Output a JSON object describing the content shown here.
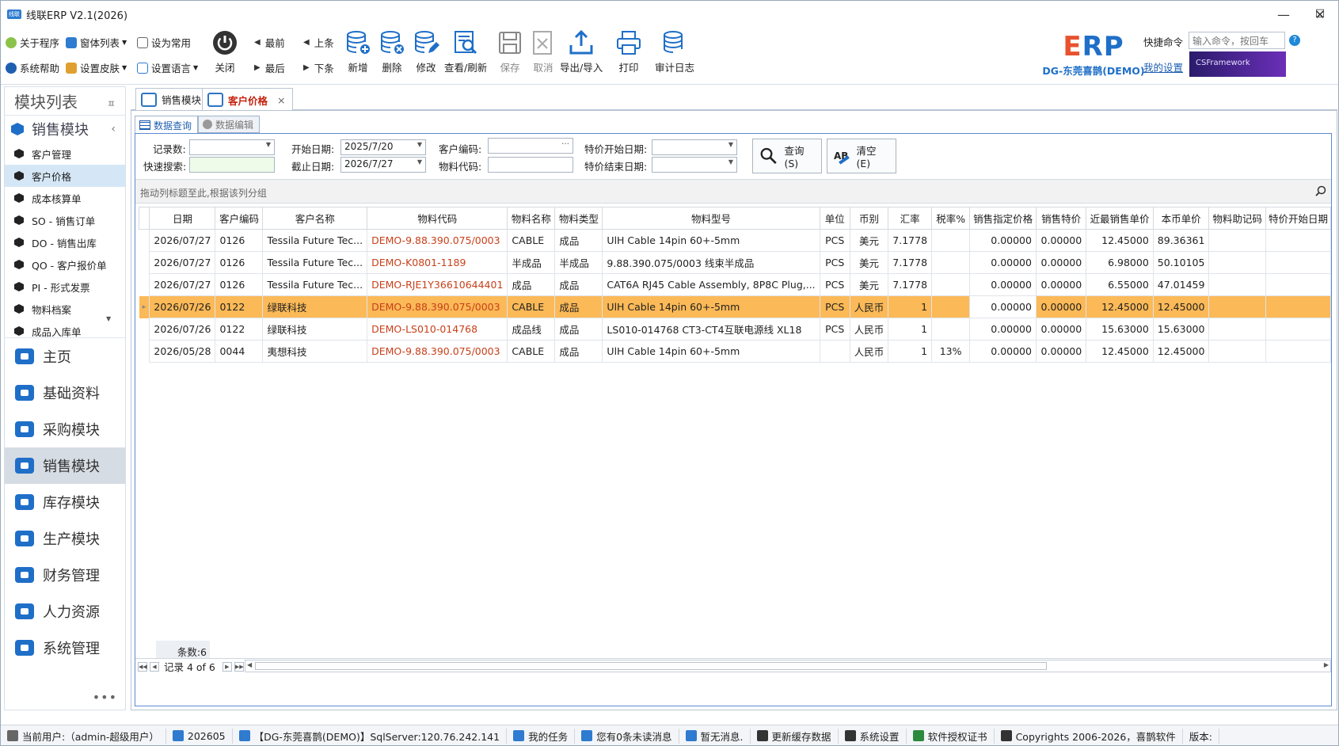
{
  "window": {
    "title": "线联ERP V2.1(2026)",
    "logo_text": "线联"
  },
  "toolbar": {
    "about": "关于程序",
    "window_list": "窗体列表",
    "set_common": "设为常用",
    "help": "系统帮助",
    "skin": "设置皮肤",
    "language": "设置语言",
    "close": "关闭",
    "first": "最前",
    "prev": "上条",
    "last": "最后",
    "next": "下条",
    "add": "新增",
    "delete": "删除",
    "edit": "修改",
    "view": "查看/刷新",
    "save": "保存",
    "cancel": "取消",
    "export": "导出/导入",
    "print": "打印",
    "audit": "审计日志"
  },
  "brand": {
    "erp_e": "E",
    "erp_rest": "RP",
    "company": "DG-东莞喜鹊(DEMO)",
    "framework": "CSFramework"
  },
  "quick": {
    "label": "快捷命令",
    "placeholder": "输入命令，按回车",
    "help": "?",
    "my_settings": "我的设置"
  },
  "sidebar": {
    "title": "模块列表",
    "pin": "ㅍ",
    "group": "销售模块",
    "items": [
      "客户管理",
      "客户价格",
      "成本核算单",
      "SO - 销售订单",
      "DO - 销售出库",
      "QO - 客户报价单",
      "PI - 形式发票",
      "物料档案",
      "成品入库单"
    ],
    "modules": [
      "主页",
      "基础资料",
      "采购模块",
      "销售模块",
      "库存模块",
      "生产模块",
      "财务管理",
      "人力资源",
      "系统管理"
    ]
  },
  "tabs": [
    {
      "label": "销售模块"
    },
    {
      "label": "客户价格"
    }
  ],
  "subtabs": [
    "数据查询",
    "数据编辑"
  ],
  "filter": {
    "record_count_label": "记录数:",
    "quick_search_label": "快速搜索:",
    "start_date_label": "开始日期:",
    "start_date": "2025/7/20",
    "end_date_label": "截止日期:",
    "end_date": "2026/7/27",
    "customer_code_label": "客户编码:",
    "material_code_label": "物料代码:",
    "special_start_label": "特价开始日期:",
    "special_end_label": "特价结束日期:",
    "query_button": "查询(S)",
    "clear_button": "清空(E)"
  },
  "grid": {
    "group_hint": "拖动列标题至此,根据该列分组",
    "columns": [
      "日期",
      "客户编码",
      "客户名称",
      "物料代码",
      "物料名称",
      "物料类型",
      "物料型号",
      "单位",
      "币别",
      "汇率",
      "税率%",
      "销售指定价格",
      "销售特价",
      "近最销售单价",
      "本币单价",
      "物料助记码",
      "特价开始日期"
    ],
    "rows": [
      [
        "2026/07/27",
        "0126",
        "Tessila Future Tec...",
        "DEMO-9.88.390.075/0003",
        "CABLE",
        "成品",
        "UlH Cable 14pin 60+-5mm",
        "PCS",
        "美元",
        "7.1778",
        "",
        "0.00000",
        "0.00000",
        "12.45000",
        "89.36361",
        "",
        ""
      ],
      [
        "2026/07/27",
        "0126",
        "Tessila Future Tec...",
        "DEMO-K0801-1189",
        "半成品",
        "半成品",
        "9.88.390.075/0003 线束半成品",
        "PCS",
        "美元",
        "7.1778",
        "",
        "0.00000",
        "0.00000",
        "6.98000",
        "50.10105",
        "",
        ""
      ],
      [
        "2026/07/27",
        "0126",
        "Tessila Future Tec...",
        "DEMO-RJE1Y36610644401",
        "成品",
        "成品",
        "CAT6A RJ45 Cable Assembly, 8P8C Plug,...",
        "PCS",
        "美元",
        "7.1778",
        "",
        "0.00000",
        "0.00000",
        "6.55000",
        "47.01459",
        "",
        ""
      ],
      [
        "2026/07/26",
        "0122",
        "绿联科技",
        "DEMO-9.88.390.075/0003",
        "CABLE",
        "成品",
        "UlH Cable 14pin 60+-5mm",
        "PCS",
        "人民币",
        "1",
        "",
        "0.00000",
        "0.00000",
        "12.45000",
        "12.45000",
        "",
        ""
      ],
      [
        "2026/07/26",
        "0122",
        "绿联科技",
        "DEMO-LS010-014768",
        "成品线",
        "成品",
        "LS010-014768 CT3-CT4互联电源线 XL18",
        "PCS",
        "人民币",
        "1",
        "",
        "0.00000",
        "0.00000",
        "15.63000",
        "15.63000",
        "",
        ""
      ],
      [
        "2026/05/28",
        "0044",
        "夷想科技",
        "DEMO-9.88.390.075/0003",
        "CABLE",
        "成品",
        "UlH Cable 14pin 60+-5mm",
        "",
        "人民币",
        "1",
        "13%",
        "0.00000",
        "0.00000",
        "12.45000",
        "12.45000",
        "",
        ""
      ]
    ],
    "selected_row": 3,
    "count_label": "条数:6",
    "record_nav": "记录 4 of 6"
  },
  "status": [
    "当前用户:（admin-超级用户）",
    "202605",
    "【DG-东莞喜鹊(DEMO)】SqlServer:120.76.242.141",
    "我的任务",
    "您有0条未读消息",
    "暂无消息.",
    "更新缓存数据",
    "系统设置",
    "软件授权证书",
    "Copyrights 2006-2026，喜鹊软件",
    "版本:"
  ],
  "colors": {
    "accent": "#1f6fc8",
    "selected_row": "#fbb957",
    "link_red": "#c8401a"
  }
}
